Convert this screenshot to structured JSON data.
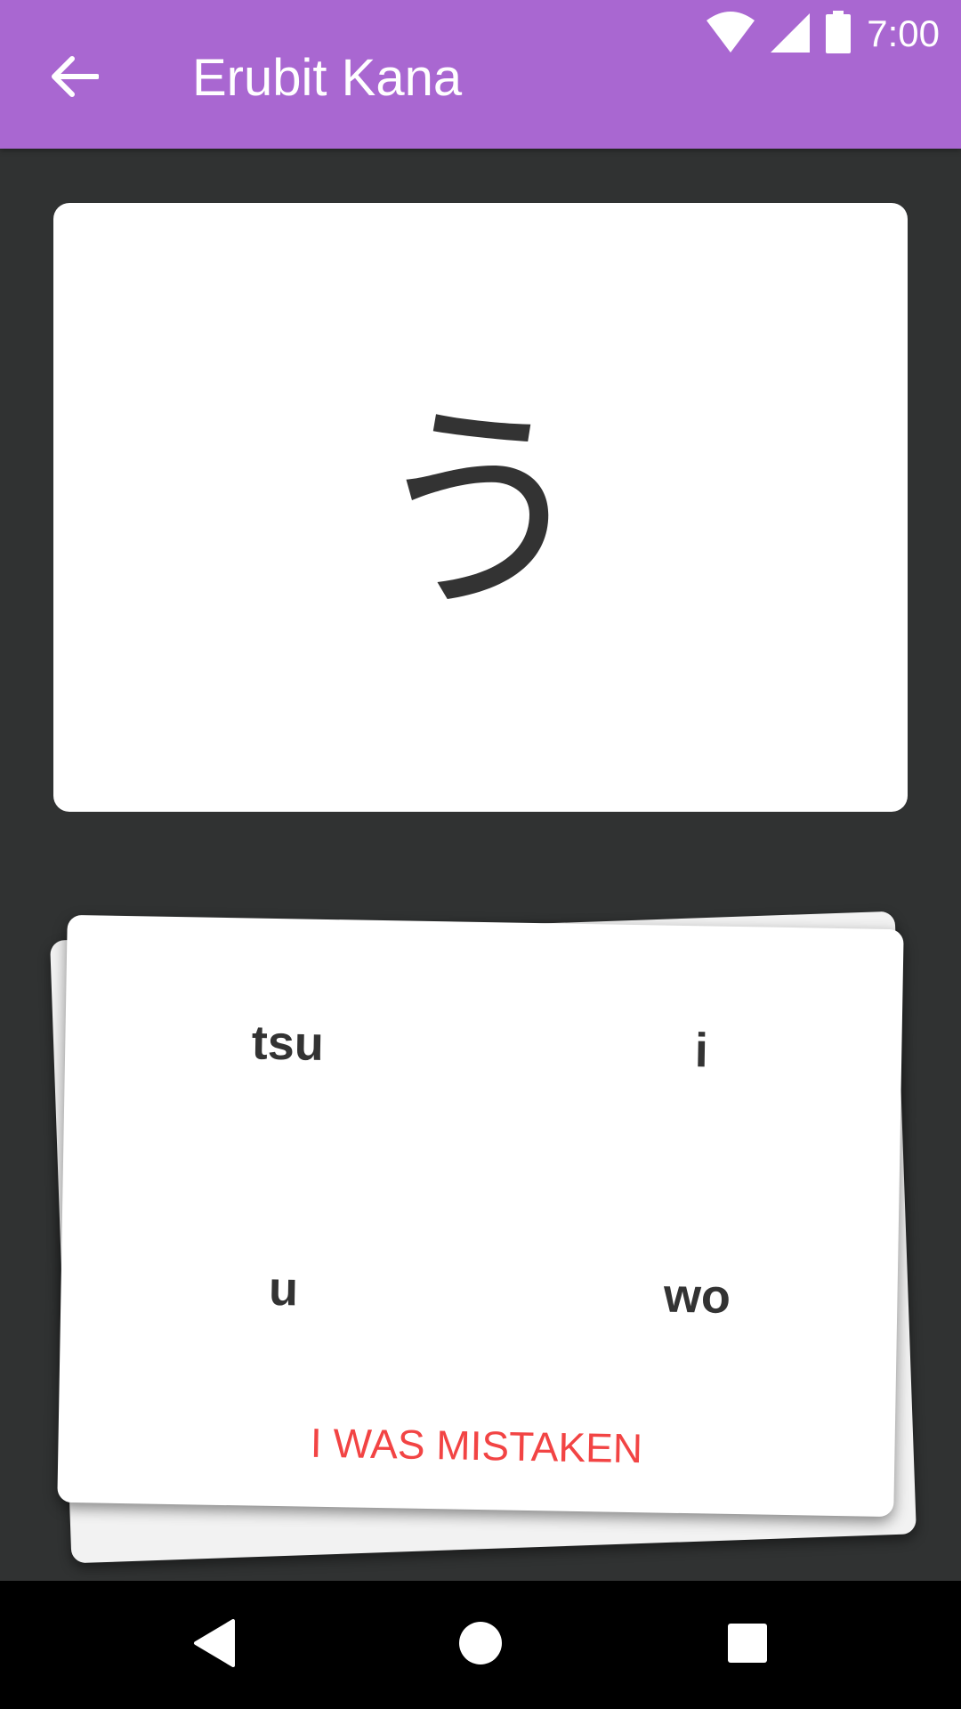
{
  "status_bar": {
    "time": "7:00",
    "icons": [
      "wifi-icon",
      "signal-icon",
      "battery-icon"
    ]
  },
  "app_bar": {
    "title": "Erubit Kana",
    "background_color": "#a967d1",
    "back_icon": "arrow-back-icon"
  },
  "question": {
    "kana": "う"
  },
  "answers": {
    "options": [
      "tsu",
      "i",
      "u",
      "wo"
    ],
    "mistaken_label": "I WAS MISTAKEN",
    "mistaken_color": "#f24444"
  },
  "nav_bar": {
    "icons": [
      "nav-back-icon",
      "nav-home-icon",
      "nav-recent-apps-icon"
    ]
  }
}
